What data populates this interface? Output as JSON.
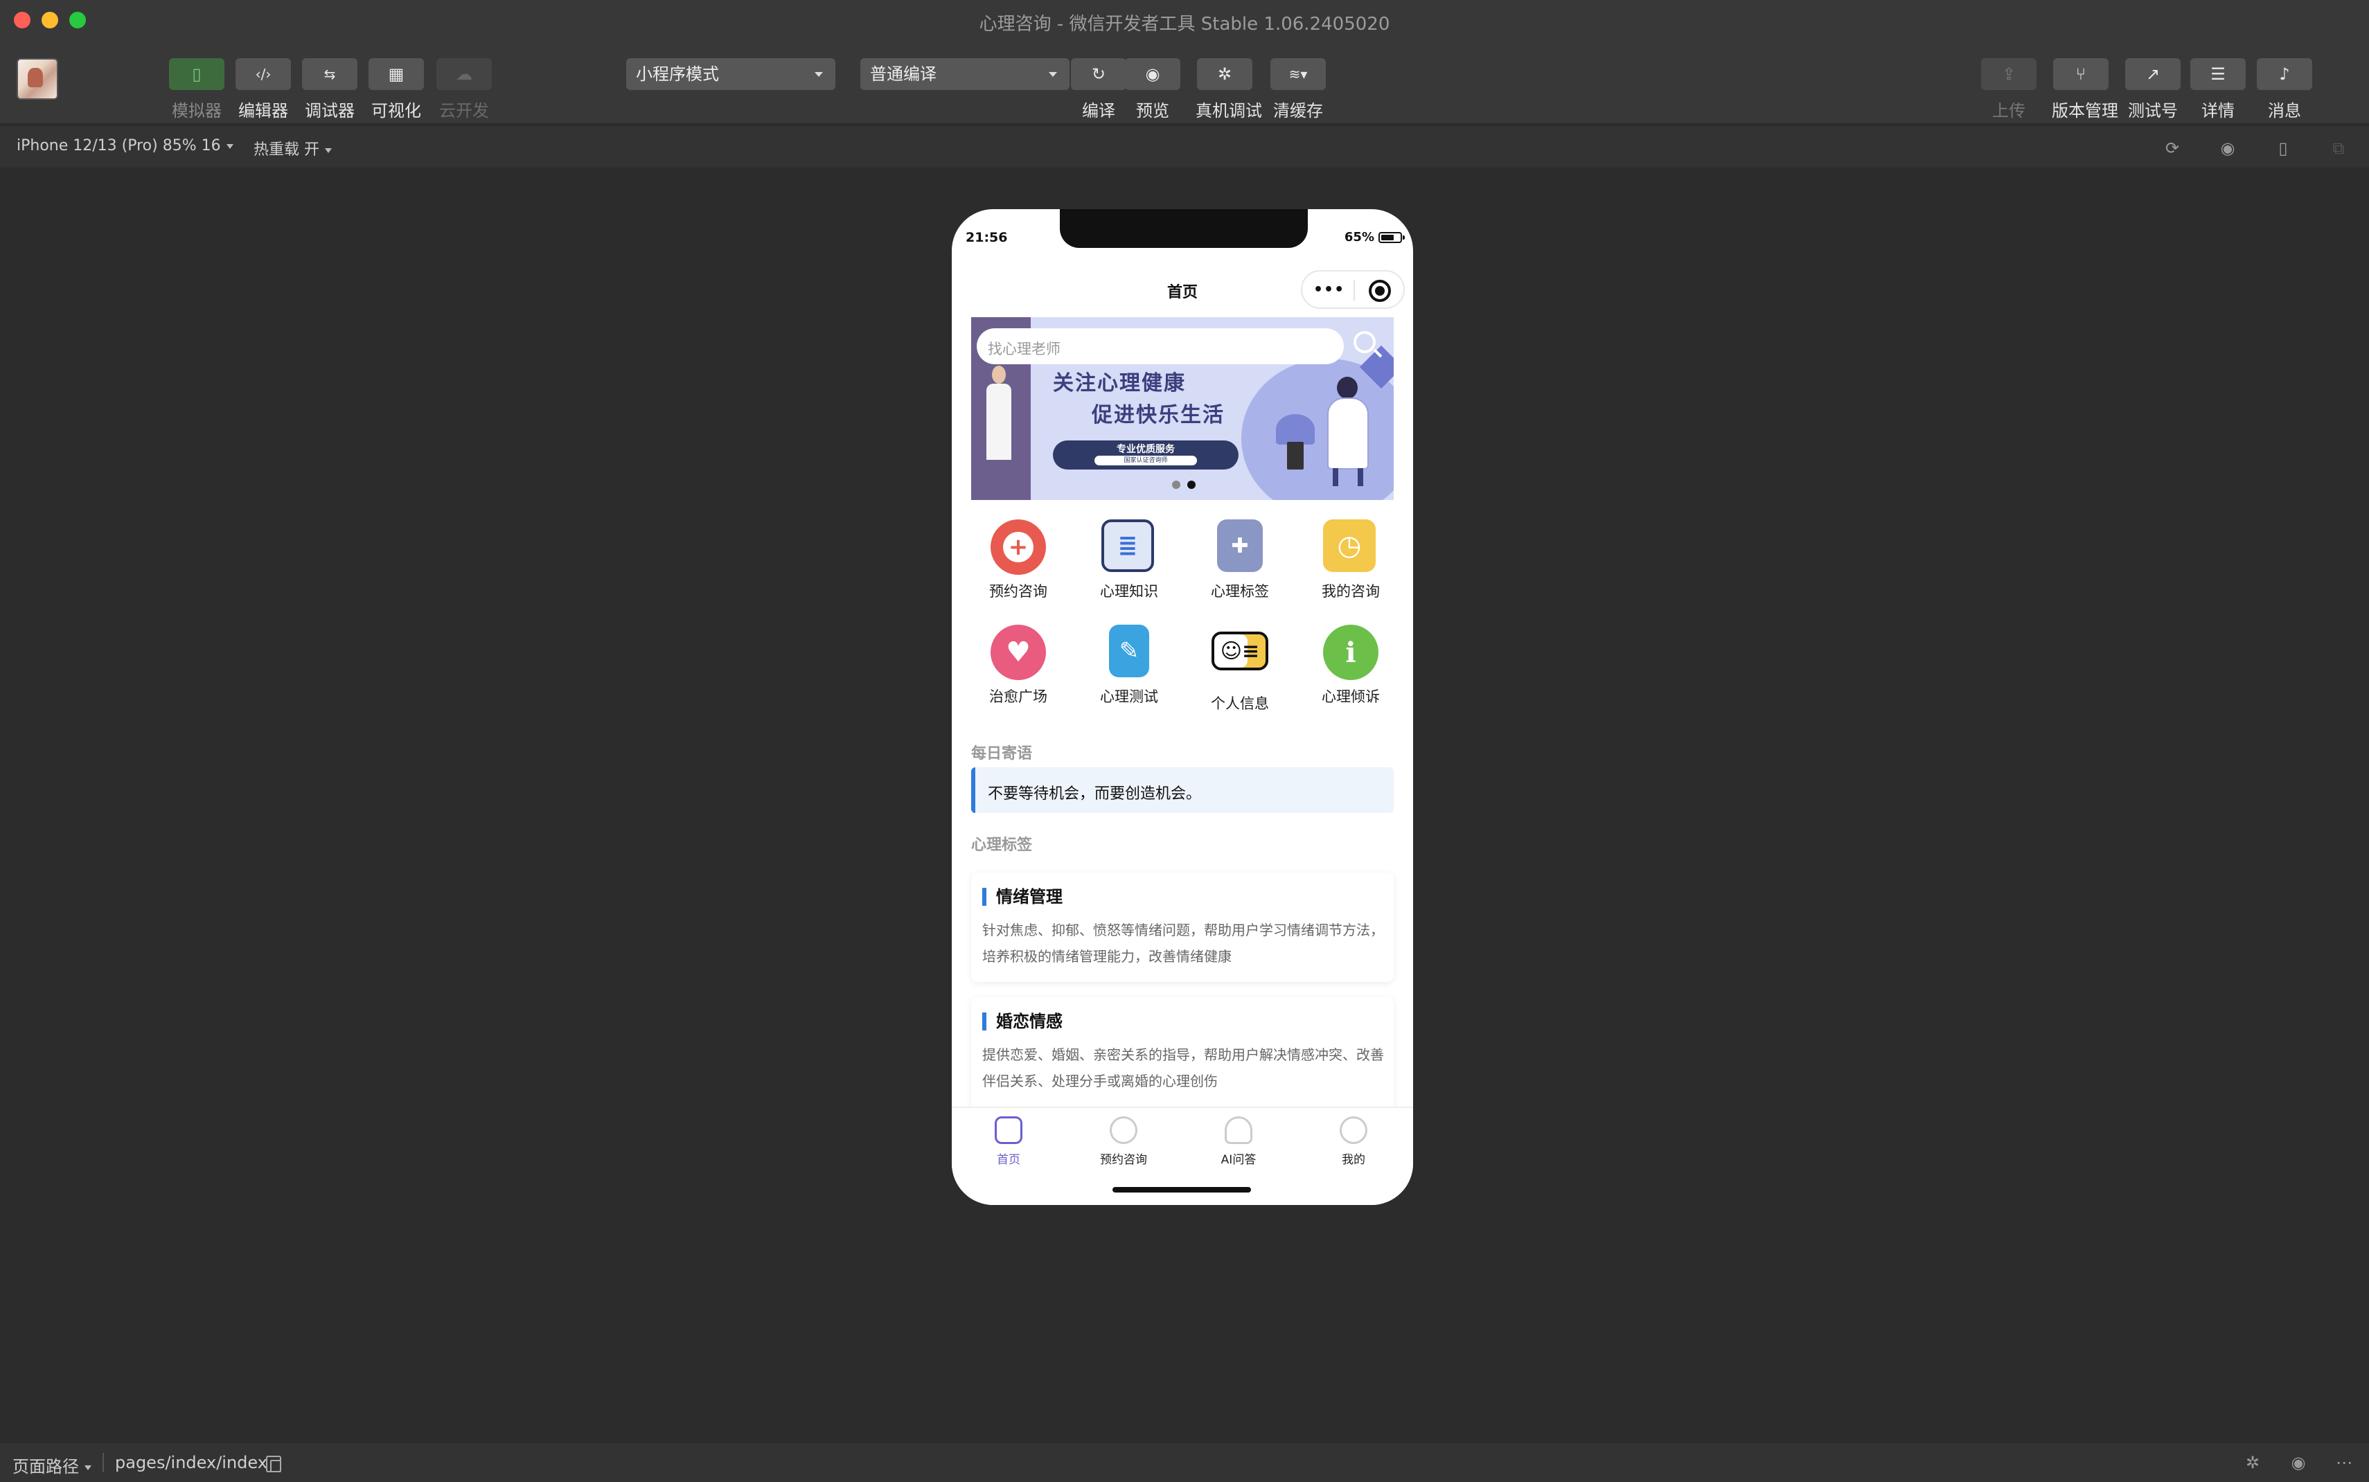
{
  "window": {
    "title": "心理咨询 - 微信开发者工具 Stable 1.06.2405020"
  },
  "toolbar": {
    "left_tools": [
      {
        "label": "模拟器",
        "icon": "phone-icon"
      },
      {
        "label": "编辑器",
        "icon": "code-icon"
      },
      {
        "label": "调试器",
        "icon": "debugger-icon"
      },
      {
        "label": "可视化",
        "icon": "layout-icon"
      },
      {
        "label": "云开发",
        "icon": "cloud-icon"
      }
    ],
    "mode_select": "小程序模式",
    "compile_select": "普通编译",
    "mid_tools": [
      {
        "label": "编译",
        "icon": "refresh-icon"
      },
      {
        "label": "预览",
        "icon": "eye-icon"
      },
      {
        "label": "真机调试",
        "icon": "bug-icon"
      },
      {
        "label": "清缓存",
        "icon": "layers-icon"
      }
    ],
    "right_tools": [
      {
        "label": "上传",
        "icon": "upload-icon"
      },
      {
        "label": "版本管理",
        "icon": "branch-icon"
      },
      {
        "label": "测试号",
        "icon": "external-link-icon"
      },
      {
        "label": "详情",
        "icon": "menu-icon"
      },
      {
        "label": "消息",
        "icon": "bell-icon"
      }
    ]
  },
  "subbar": {
    "device": "iPhone 12/13 (Pro) 85% 16",
    "hot_reload": "热重载 开"
  },
  "phone": {
    "time": "21:56",
    "battery": "65%",
    "nav_title": "首页",
    "search_placeholder": "找心理老师",
    "banner": {
      "line1": "关注心理健康",
      "line2": "促进快乐生活",
      "pill_text": "专业优质服务",
      "pill_sub": "国家认证咨询师"
    },
    "grid": [
      {
        "label": "预约咨询",
        "icon": "appointment-icon",
        "color": "#e85a4f"
      },
      {
        "label": "心理知识",
        "icon": "newspaper-icon",
        "color": "#3a6fd8"
      },
      {
        "label": "心理标签",
        "icon": "building-icon",
        "color": "#7a88b8"
      },
      {
        "label": "我的咨询",
        "icon": "history-icon",
        "color": "#f3c84b"
      },
      {
        "label": "治愈广场",
        "icon": "heart-icon",
        "color": "#e95b7f"
      },
      {
        "label": "心理测试",
        "icon": "test-report-icon",
        "color": "#3aa3e0"
      },
      {
        "label": "个人信息",
        "icon": "id-card-icon",
        "color": "#f3c84b"
      },
      {
        "label": "心理倾诉",
        "icon": "info-icon",
        "color": "#6cc04a"
      }
    ],
    "daily_title": "每日寄语",
    "daily_quote": "不要等待机会，而要创造机会。",
    "tags_title": "心理标签",
    "cards": [
      {
        "title": "情绪管理",
        "desc": "针对焦虑、抑郁、愤怒等情绪问题，帮助用户学习情绪调节方法，培养积极的情绪管理能力，改善情绪健康"
      },
      {
        "title": "婚恋情感",
        "desc": "提供恋爱、婚姻、亲密关系的指导，帮助用户解决情感冲突、改善伴侣关系、处理分手或离婚的心理创伤"
      }
    ],
    "tabs": [
      {
        "label": "首页",
        "icon": "home-icon"
      },
      {
        "label": "预约咨询",
        "icon": "consult-icon"
      },
      {
        "label": "AI问答",
        "icon": "ai-icon"
      },
      {
        "label": "我的",
        "icon": "user-icon"
      }
    ]
  },
  "statusbar": {
    "path_label": "页面路径",
    "path_value": "pages/index/index"
  }
}
